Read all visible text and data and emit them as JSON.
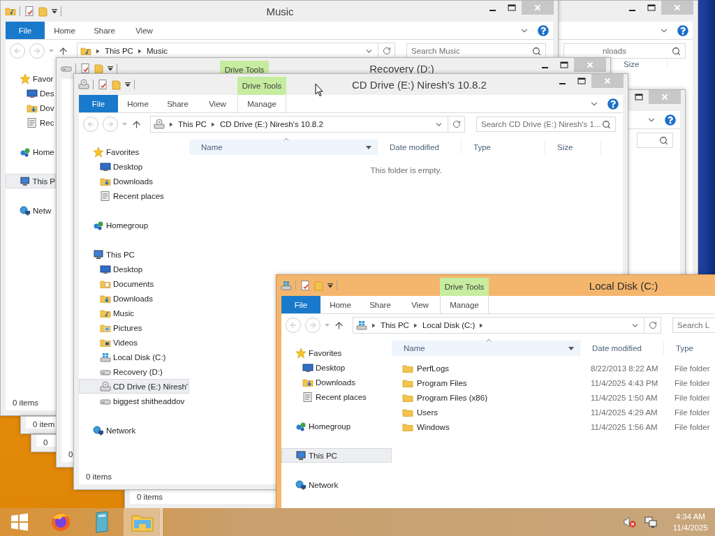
{
  "windows": [
    {
      "active": false,
      "search_placeholder": "nloads",
      "columns": [
        {
          "label": "Size"
        }
      ]
    },
    {
      "active": false
    },
    {
      "kind": "music",
      "active": false,
      "title": "Music",
      "file_tab": "File",
      "tabs": [
        {
          "label": "Home",
          "kind": "normal"
        },
        {
          "label": "Share",
          "kind": "normal"
        },
        {
          "label": "View",
          "kind": "normal"
        }
      ],
      "address": [
        "This PC",
        "Music"
      ],
      "trailing_separator": false,
      "search_placeholder": "Search Music",
      "nav": [
        {
          "label": "Favor",
          "kind": "star",
          "selected": false,
          "children": [
            {
              "label": "Des",
              "kind": "desktop",
              "selected": false
            },
            {
              "label": "Dov",
              "kind": "downloads",
              "selected": false
            },
            {
              "label": "Rec",
              "kind": "recent",
              "selected": false
            }
          ]
        },
        {
          "label": "Home",
          "kind": "homegroup",
          "selected": false
        },
        {
          "label": "This P",
          "kind": "pc",
          "selected": true
        },
        {
          "label": "Netw",
          "kind": "network",
          "selected": false
        }
      ],
      "status": "0 items"
    },
    {
      "active": false,
      "status": "0 item"
    },
    {
      "active": false,
      "status": "0"
    },
    {
      "kind": "drive",
      "active": false,
      "title": "Recovery (D:)",
      "context_tab": "Drive Tools",
      "status": "0"
    },
    {
      "active": false,
      "status": "0 items"
    },
    {
      "kind": "cd",
      "active": false,
      "title": "CD Drive (E:) Niresh's 10.8.2",
      "context_tab": "Drive Tools",
      "file_tab": "File",
      "tabs": [
        {
          "label": "Home",
          "kind": "normal"
        },
        {
          "label": "Share",
          "kind": "normal"
        },
        {
          "label": "View",
          "kind": "normal"
        },
        {
          "label": "Manage",
          "kind": "contextual"
        }
      ],
      "address": [
        "This PC",
        "CD Drive (E:) Niresh's 10.8.2"
      ],
      "trailing_separator": false,
      "search_placeholder": "Search CD Drive (E:) Niresh's 1...",
      "columns": [
        {
          "label": "Name",
          "sorted": true
        },
        {
          "label": "Date modified",
          "sorted": false
        },
        {
          "label": "Type",
          "sorted": false
        },
        {
          "label": "Size",
          "sorted": false
        }
      ],
      "empty_message": "This folder is empty.",
      "nav": [
        {
          "label": "Favorites",
          "kind": "star",
          "selected": false,
          "children": [
            {
              "label": "Desktop",
              "kind": "desktop",
              "selected": false
            },
            {
              "label": "Downloads",
              "kind": "downloads",
              "selected": false
            },
            {
              "label": "Recent places",
              "kind": "recent",
              "selected": false
            }
          ]
        },
        {
          "label": "Homegroup",
          "kind": "homegroup",
          "selected": false
        },
        {
          "label": "This PC",
          "kind": "pc",
          "selected": false,
          "children": [
            {
              "label": "Desktop",
              "kind": "desktop",
              "selected": false
            },
            {
              "label": "Documents",
              "kind": "documents",
              "selected": false
            },
            {
              "label": "Downloads",
              "kind": "downloads",
              "selected": false
            },
            {
              "label": "Music",
              "kind": "music",
              "selected": false
            },
            {
              "label": "Pictures",
              "kind": "pictures",
              "selected": false
            },
            {
              "label": "Videos",
              "kind": "videos",
              "selected": false
            },
            {
              "label": "Local Disk (C:)",
              "kind": "disk",
              "selected": false
            },
            {
              "label": "Recovery (D:)",
              "kind": "drive",
              "selected": false
            },
            {
              "label": "CD Drive (E:) Niresh'",
              "kind": "cd",
              "selected": true
            },
            {
              "label": "biggest shitheaddov",
              "kind": "drive",
              "selected": false
            }
          ]
        },
        {
          "label": "Network",
          "kind": "network",
          "selected": false
        }
      ],
      "status": "0 items"
    },
    {
      "kind": "disk",
      "active": true,
      "title": "Local Disk (C:)",
      "context_tab": "Drive Tools",
      "file_tab": "File",
      "tabs": [
        {
          "label": "Home",
          "kind": "normal"
        },
        {
          "label": "Share",
          "kind": "normal"
        },
        {
          "label": "View",
          "kind": "normal"
        },
        {
          "label": "Manage",
          "kind": "contextual"
        }
      ],
      "address": [
        "This PC",
        "Local Disk (C:)"
      ],
      "trailing_separator": true,
      "search_placeholder": "Search L",
      "columns": [
        {
          "label": "Name",
          "sorted": true
        },
        {
          "label": "Date modified",
          "sorted": false
        },
        {
          "label": "Type",
          "sorted": false
        }
      ],
      "rows": [
        {
          "name": "PerfLogs",
          "date_modified": "8/22/2013 8:22 AM",
          "type": "File folder"
        },
        {
          "name": "Program Files",
          "date_modified": "11/4/2025 4:43 PM",
          "type": "File folder"
        },
        {
          "name": "Program Files (x86)",
          "date_modified": "11/4/2025 1:50 AM",
          "type": "File folder"
        },
        {
          "name": "Users",
          "date_modified": "11/4/2025 4:29 AM",
          "type": "File folder"
        },
        {
          "name": "Windows",
          "date_modified": "11/4/2025 1:56 AM",
          "type": "File folder"
        }
      ],
      "nav": [
        {
          "label": "Favorites",
          "kind": "star",
          "selected": false,
          "children": [
            {
              "label": "Desktop",
              "kind": "desktop",
              "selected": false
            },
            {
              "label": "Downloads",
              "kind": "downloads",
              "selected": false
            },
            {
              "label": "Recent places",
              "kind": "recent",
              "selected": false
            }
          ]
        },
        {
          "label": "Homegroup",
          "kind": "homegroup",
          "selected": false
        },
        {
          "label": "This PC",
          "kind": "pc",
          "selected": true
        },
        {
          "label": "Network",
          "kind": "network",
          "selected": false
        }
      ]
    }
  ],
  "taskbar": {
    "buttons": [
      {
        "kind": "start",
        "active": false
      },
      {
        "kind": "browser",
        "active": false
      },
      {
        "kind": "book",
        "active": false
      },
      {
        "kind": "explorer",
        "active": true
      }
    ],
    "clock_time": "4:34 AM",
    "clock_date": "11/4/2025"
  }
}
